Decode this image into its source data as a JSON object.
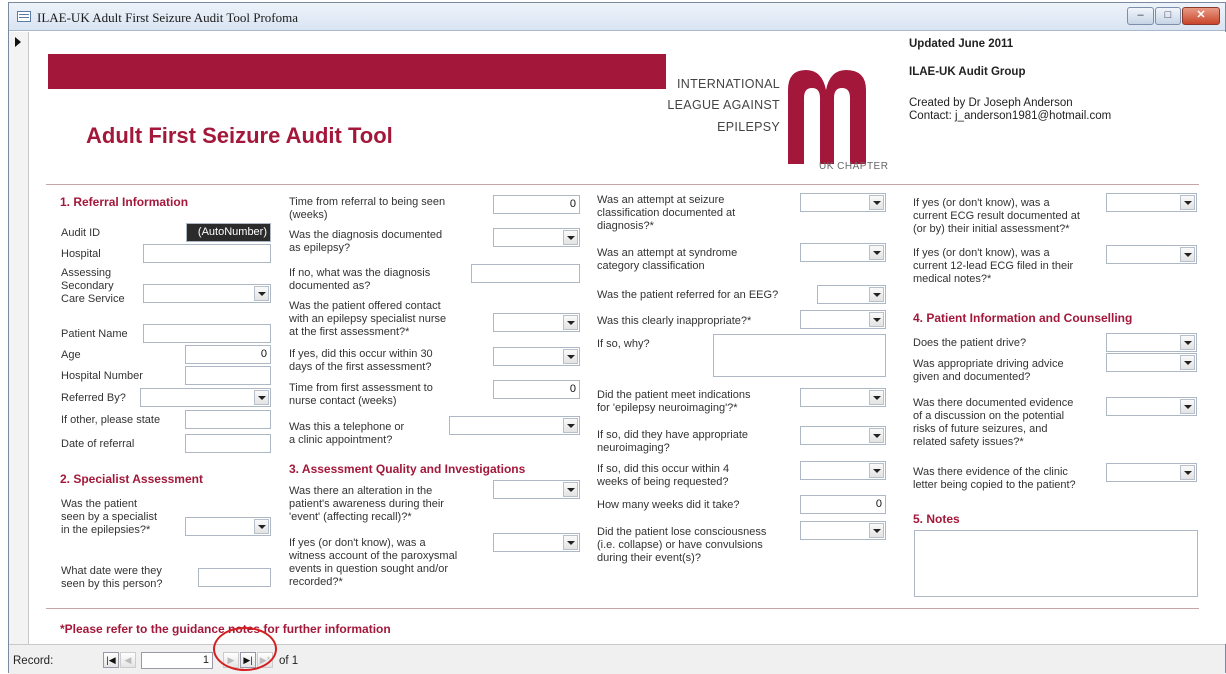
{
  "window": {
    "title": "ILAE-UK Adult First Seizure Audit Tool Profoma",
    "min_glyph": "–",
    "max_glyph": "□",
    "close_glyph": "✕"
  },
  "header": {
    "main_title": "Adult First Seizure Audit Tool",
    "logo_line1": "INTERNATIONAL",
    "logo_line2": "LEAGUE AGAINST",
    "logo_line3": "EPILEPSY",
    "logo_chapter": "UK CHAPTER",
    "updated": "Updated June 2011",
    "group": "ILAE-UK Audit Group",
    "created_by": "Created by Dr Joseph Anderson",
    "contact": "Contact: j_anderson1981@hotmail.com",
    "accent_color": "#a3183a"
  },
  "sections": {
    "s1": "1. Referral Information",
    "s2": "2. Specialist Assessment",
    "s3": "3. Assessment Quality and Investigations",
    "s4": "4. Patient Information and Counselling",
    "s5": "5. Notes"
  },
  "col1": {
    "audit_id_label": "Audit ID",
    "audit_id_value": "(AutoNumber)",
    "hospital_label": "Hospital",
    "assessing_l1": "Assessing",
    "assessing_l2": "Secondary",
    "assessing_l3": "Care Service",
    "patient_name_label": "Patient Name",
    "age_label": "Age",
    "age_value": "0",
    "hospital_number_label": "Hospital Number",
    "referred_by_label": "Referred By?",
    "if_other_label": "If other, please state",
    "date_referral_label": "Date of referral",
    "seen_l1": "Was the patient",
    "seen_l2": "seen by a specialist",
    "seen_l3": "in the epilepsies?*",
    "date_seen_l1": "What date were they",
    "date_seen_l2": "seen by this person?"
  },
  "col2": {
    "time_ref_l1": "Time from referral to being seen",
    "time_ref_l2": "(weeks)",
    "time_ref_value": "0",
    "diag_l1": "Was the diagnosis documented",
    "diag_l2": "as epilepsy?",
    "ifno_l1": "If no, what was the diagnosis",
    "ifno_l2": "documented as?",
    "offered_l1": "Was the patient offered contact",
    "offered_l2": "with an epilepsy specialist nurse",
    "offered_l3": "at the first assessment?*",
    "within30_l1": "If yes, did this occur within 30",
    "within30_l2": "days of the first assessment?",
    "nurse_l1": "Time from first assessment to",
    "nurse_l2": "nurse contact (weeks)",
    "nurse_value": "0",
    "tel_l1": "Was this a telephone or",
    "tel_l2": "a clinic appointment?",
    "alter_l1": "Was there an alteration in the",
    "alter_l2": "patient's awareness during their",
    "alter_l3": "'event' (affecting recall)?*",
    "witness_l1": "If yes (or don't know), was a",
    "witness_l2": "witness account of the paroxysmal",
    "witness_l3": "events in question sought and/or",
    "witness_l4": "recorded?*"
  },
  "col3": {
    "seizure_l1": "Was an attempt at seizure",
    "seizure_l2": "classification documented at",
    "seizure_l3": "diagnosis?*",
    "syndrome_l1": "Was an attempt at syndrome",
    "syndrome_l2": "category classification",
    "eeg": "Was the patient referred for an EEG?",
    "inapprop": "Was this clearly inappropriate?*",
    "ifso_why": "If so, why?",
    "neuro_l1": "Did the patient meet indications",
    "neuro_l2": "for 'epilepsy neuroimaging'?*",
    "approp_l1": "If so, did they have appropriate",
    "approp_l2": "neuroimaging?",
    "within4_l1": "If so, did this occur within 4",
    "within4_l2": "weeks of being requested?",
    "howmany": "How many weeks did it take?",
    "howmany_value": "0",
    "lose_l1": "Did the patient lose consciousness",
    "lose_l2": "(i.e. collapse) or have convulsions",
    "lose_l3": "during their event(s)?"
  },
  "col4": {
    "ecg_l1": "If yes (or don't know), was a",
    "ecg_l2": "current ECG result documented at",
    "ecg_l3": "(or by) their initial assessment?*",
    "ecg12_l1": "If yes (or don't know), was a",
    "ecg12_l2": "current 12-lead ECG filed in their",
    "ecg12_l3": "medical notes?*",
    "drive": "Does the patient drive?",
    "driving_l1": "Was appropriate driving advice",
    "driving_l2": "given and documented?",
    "risks_l1": "Was there documented evidence",
    "risks_l2": "of a discussion on the potential",
    "risks_l3": "risks of future seizures, and",
    "risks_l4": "related safety issues?*",
    "letter_l1": "Was there evidence of the clinic",
    "letter_l2": "letter being copied to the patient?"
  },
  "footer": {
    "guidance": "*Please refer to the guidance notes for further information"
  },
  "navigation": {
    "record_label": "Record:",
    "first_glyph": "|◀",
    "prev_glyph": "◀",
    "current": "1",
    "next_glyph": "▶",
    "last_glyph": "▶|",
    "new_glyph": "▶*",
    "of_text": "of 1"
  }
}
